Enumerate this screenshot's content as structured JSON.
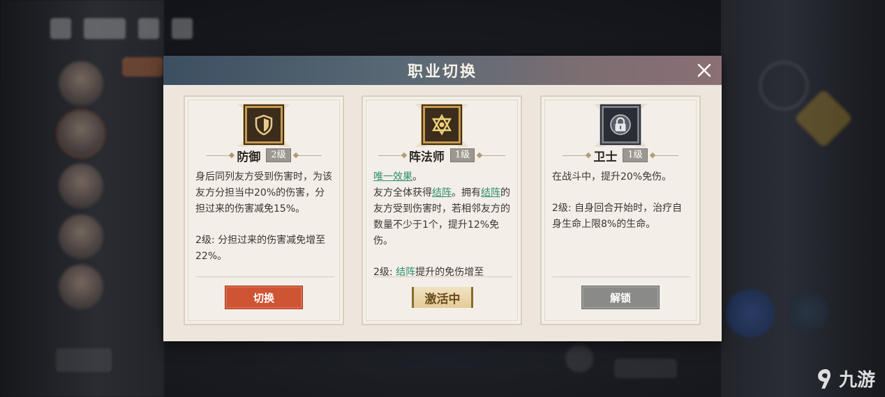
{
  "modal": {
    "title": "职业切换"
  },
  "cards": [
    {
      "name": "防御",
      "level": "2级",
      "icon": "shield-icon",
      "desc_1": "身后同列友方受到伤害时，为该友方分担当中20%的伤害，分担过来的伤害减免15%。",
      "desc_2": "2级: 分担过来的伤害减免增至22%。",
      "action_label": "切换"
    },
    {
      "name": "阵法师",
      "level": "1级",
      "icon": "star-of-david-icon",
      "unique_effect": "唯一效果",
      "unique_effect_suffix": "。",
      "desc_1a": "友方全体获得",
      "formation_1": "结阵",
      "desc_1b": "。拥有",
      "formation_2": "结阵",
      "desc_1c": "的友方受到伤害时，若相邻友方的数量不少于1个，提升12%免伤。",
      "desc_2a": "2级: ",
      "formation_3": "结阵",
      "desc_2b": "提升的免伤增至",
      "status_label": "激活中"
    },
    {
      "name": "卫士",
      "level": "1级",
      "icon": "lock-icon",
      "desc_1": "在战斗中，提升20%免伤。",
      "desc_2": "2级: 自身回合开始时，治疗自身生命上限8%的生命。",
      "action_label": "解锁"
    }
  ],
  "watermark": {
    "text": "九游"
  },
  "colors": {
    "switch_button": "#cf5434",
    "highlight_text": "#2f8f6a",
    "unlock_button": "#8a8a88",
    "header_start": "#3c4f61",
    "header_end": "#8a6f74"
  }
}
